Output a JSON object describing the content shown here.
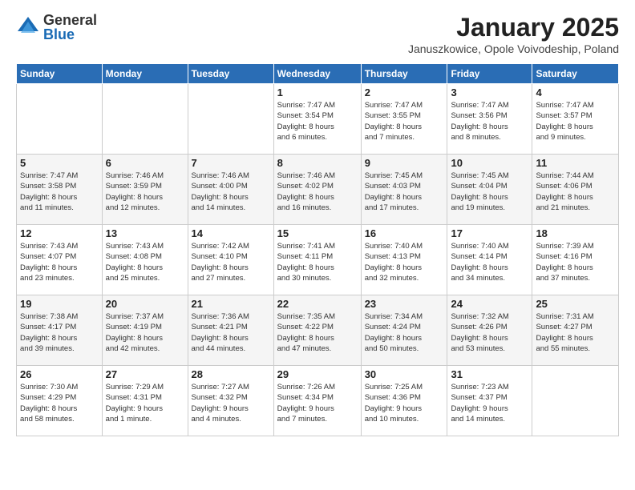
{
  "header": {
    "logo_general": "General",
    "logo_blue": "Blue",
    "title": "January 2025",
    "location": "Januszkowice, Opole Voivodeship, Poland"
  },
  "weekdays": [
    "Sunday",
    "Monday",
    "Tuesday",
    "Wednesday",
    "Thursday",
    "Friday",
    "Saturday"
  ],
  "weeks": [
    [
      {
        "day": "",
        "detail": ""
      },
      {
        "day": "",
        "detail": ""
      },
      {
        "day": "",
        "detail": ""
      },
      {
        "day": "1",
        "detail": "Sunrise: 7:47 AM\nSunset: 3:54 PM\nDaylight: 8 hours\nand 6 minutes."
      },
      {
        "day": "2",
        "detail": "Sunrise: 7:47 AM\nSunset: 3:55 PM\nDaylight: 8 hours\nand 7 minutes."
      },
      {
        "day": "3",
        "detail": "Sunrise: 7:47 AM\nSunset: 3:56 PM\nDaylight: 8 hours\nand 8 minutes."
      },
      {
        "day": "4",
        "detail": "Sunrise: 7:47 AM\nSunset: 3:57 PM\nDaylight: 8 hours\nand 9 minutes."
      }
    ],
    [
      {
        "day": "5",
        "detail": "Sunrise: 7:47 AM\nSunset: 3:58 PM\nDaylight: 8 hours\nand 11 minutes."
      },
      {
        "day": "6",
        "detail": "Sunrise: 7:46 AM\nSunset: 3:59 PM\nDaylight: 8 hours\nand 12 minutes."
      },
      {
        "day": "7",
        "detail": "Sunrise: 7:46 AM\nSunset: 4:00 PM\nDaylight: 8 hours\nand 14 minutes."
      },
      {
        "day": "8",
        "detail": "Sunrise: 7:46 AM\nSunset: 4:02 PM\nDaylight: 8 hours\nand 16 minutes."
      },
      {
        "day": "9",
        "detail": "Sunrise: 7:45 AM\nSunset: 4:03 PM\nDaylight: 8 hours\nand 17 minutes."
      },
      {
        "day": "10",
        "detail": "Sunrise: 7:45 AM\nSunset: 4:04 PM\nDaylight: 8 hours\nand 19 minutes."
      },
      {
        "day": "11",
        "detail": "Sunrise: 7:44 AM\nSunset: 4:06 PM\nDaylight: 8 hours\nand 21 minutes."
      }
    ],
    [
      {
        "day": "12",
        "detail": "Sunrise: 7:43 AM\nSunset: 4:07 PM\nDaylight: 8 hours\nand 23 minutes."
      },
      {
        "day": "13",
        "detail": "Sunrise: 7:43 AM\nSunset: 4:08 PM\nDaylight: 8 hours\nand 25 minutes."
      },
      {
        "day": "14",
        "detail": "Sunrise: 7:42 AM\nSunset: 4:10 PM\nDaylight: 8 hours\nand 27 minutes."
      },
      {
        "day": "15",
        "detail": "Sunrise: 7:41 AM\nSunset: 4:11 PM\nDaylight: 8 hours\nand 30 minutes."
      },
      {
        "day": "16",
        "detail": "Sunrise: 7:40 AM\nSunset: 4:13 PM\nDaylight: 8 hours\nand 32 minutes."
      },
      {
        "day": "17",
        "detail": "Sunrise: 7:40 AM\nSunset: 4:14 PM\nDaylight: 8 hours\nand 34 minutes."
      },
      {
        "day": "18",
        "detail": "Sunrise: 7:39 AM\nSunset: 4:16 PM\nDaylight: 8 hours\nand 37 minutes."
      }
    ],
    [
      {
        "day": "19",
        "detail": "Sunrise: 7:38 AM\nSunset: 4:17 PM\nDaylight: 8 hours\nand 39 minutes."
      },
      {
        "day": "20",
        "detail": "Sunrise: 7:37 AM\nSunset: 4:19 PM\nDaylight: 8 hours\nand 42 minutes."
      },
      {
        "day": "21",
        "detail": "Sunrise: 7:36 AM\nSunset: 4:21 PM\nDaylight: 8 hours\nand 44 minutes."
      },
      {
        "day": "22",
        "detail": "Sunrise: 7:35 AM\nSunset: 4:22 PM\nDaylight: 8 hours\nand 47 minutes."
      },
      {
        "day": "23",
        "detail": "Sunrise: 7:34 AM\nSunset: 4:24 PM\nDaylight: 8 hours\nand 50 minutes."
      },
      {
        "day": "24",
        "detail": "Sunrise: 7:32 AM\nSunset: 4:26 PM\nDaylight: 8 hours\nand 53 minutes."
      },
      {
        "day": "25",
        "detail": "Sunrise: 7:31 AM\nSunset: 4:27 PM\nDaylight: 8 hours\nand 55 minutes."
      }
    ],
    [
      {
        "day": "26",
        "detail": "Sunrise: 7:30 AM\nSunset: 4:29 PM\nDaylight: 8 hours\nand 58 minutes."
      },
      {
        "day": "27",
        "detail": "Sunrise: 7:29 AM\nSunset: 4:31 PM\nDaylight: 9 hours\nand 1 minute."
      },
      {
        "day": "28",
        "detail": "Sunrise: 7:27 AM\nSunset: 4:32 PM\nDaylight: 9 hours\nand 4 minutes."
      },
      {
        "day": "29",
        "detail": "Sunrise: 7:26 AM\nSunset: 4:34 PM\nDaylight: 9 hours\nand 7 minutes."
      },
      {
        "day": "30",
        "detail": "Sunrise: 7:25 AM\nSunset: 4:36 PM\nDaylight: 9 hours\nand 10 minutes."
      },
      {
        "day": "31",
        "detail": "Sunrise: 7:23 AM\nSunset: 4:37 PM\nDaylight: 9 hours\nand 14 minutes."
      },
      {
        "day": "",
        "detail": ""
      }
    ]
  ]
}
